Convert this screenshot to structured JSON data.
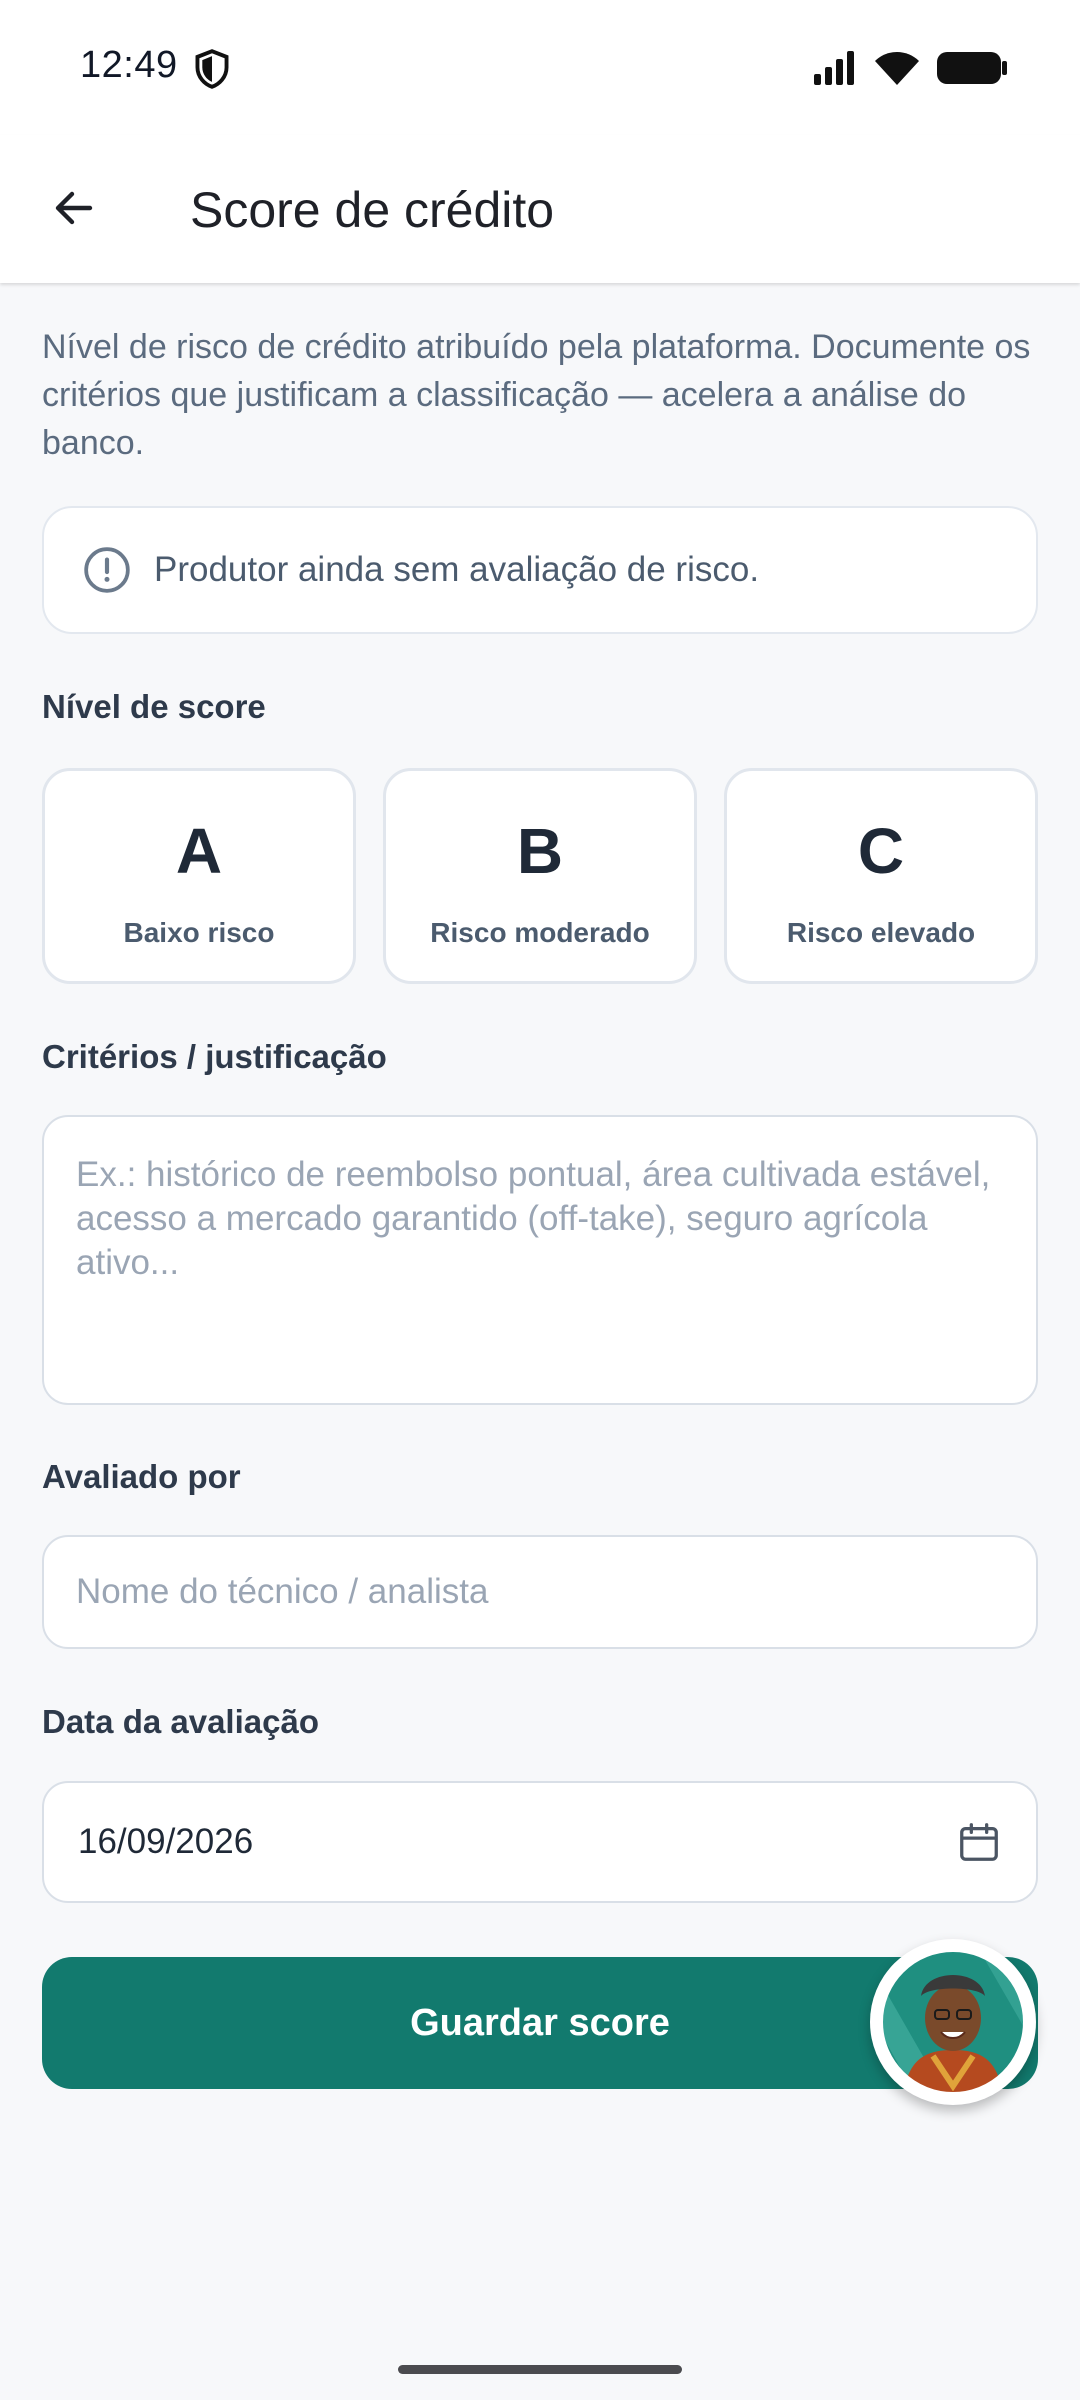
{
  "status_bar": {
    "time": "12:49"
  },
  "header": {
    "title": "Score de crédito"
  },
  "description": "Nível de risco de crédito atribuído pela plataforma. Documente os critérios que justificam a classificação — acelera a análise do banco.",
  "notice": {
    "text": "Produtor ainda sem avaliação de risco."
  },
  "score": {
    "label": "Nível de score",
    "options": [
      {
        "letter": "A",
        "description": "Baixo risco"
      },
      {
        "letter": "B",
        "description": "Risco moderado"
      },
      {
        "letter": "C",
        "description": "Risco elevado"
      }
    ]
  },
  "criteria": {
    "label": "Critérios / justificação",
    "placeholder": "Ex.: histórico de reembolso pontual, área cultivada estável, acesso a mercado garantido (off-take), seguro agrícola ativo..."
  },
  "evaluator": {
    "label": "Avaliado por",
    "placeholder": "Nome do técnico / analista"
  },
  "date": {
    "label": "Data da avaliação",
    "value": "16/09/2026"
  },
  "actions": {
    "save_label": "Guardar score"
  },
  "colors": {
    "primary": "#127a6e",
    "background": "#f7f8fa",
    "border": "#d9dfe7"
  }
}
